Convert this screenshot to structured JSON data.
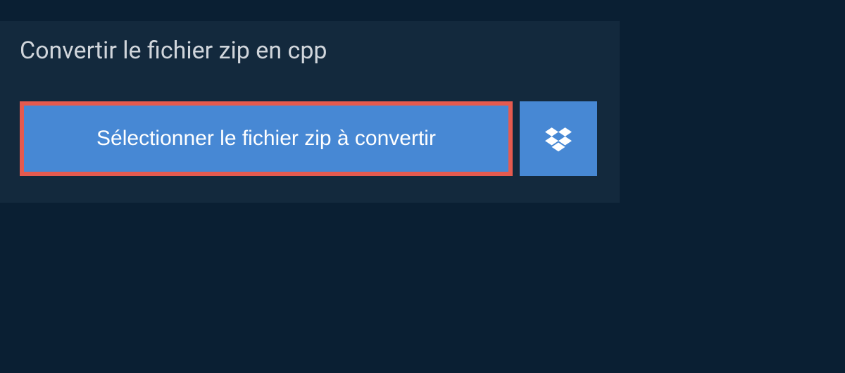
{
  "title": "Convertir le fichier zip en cpp",
  "selectButton": {
    "label": "Sélectionner le fichier zip à convertir"
  },
  "colors": {
    "background": "#0a1f33",
    "panel": "#13293d",
    "buttonPrimary": "#4788d4",
    "highlight": "#e55a4f",
    "textLight": "#d0d5db",
    "textWhite": "#ffffff"
  }
}
